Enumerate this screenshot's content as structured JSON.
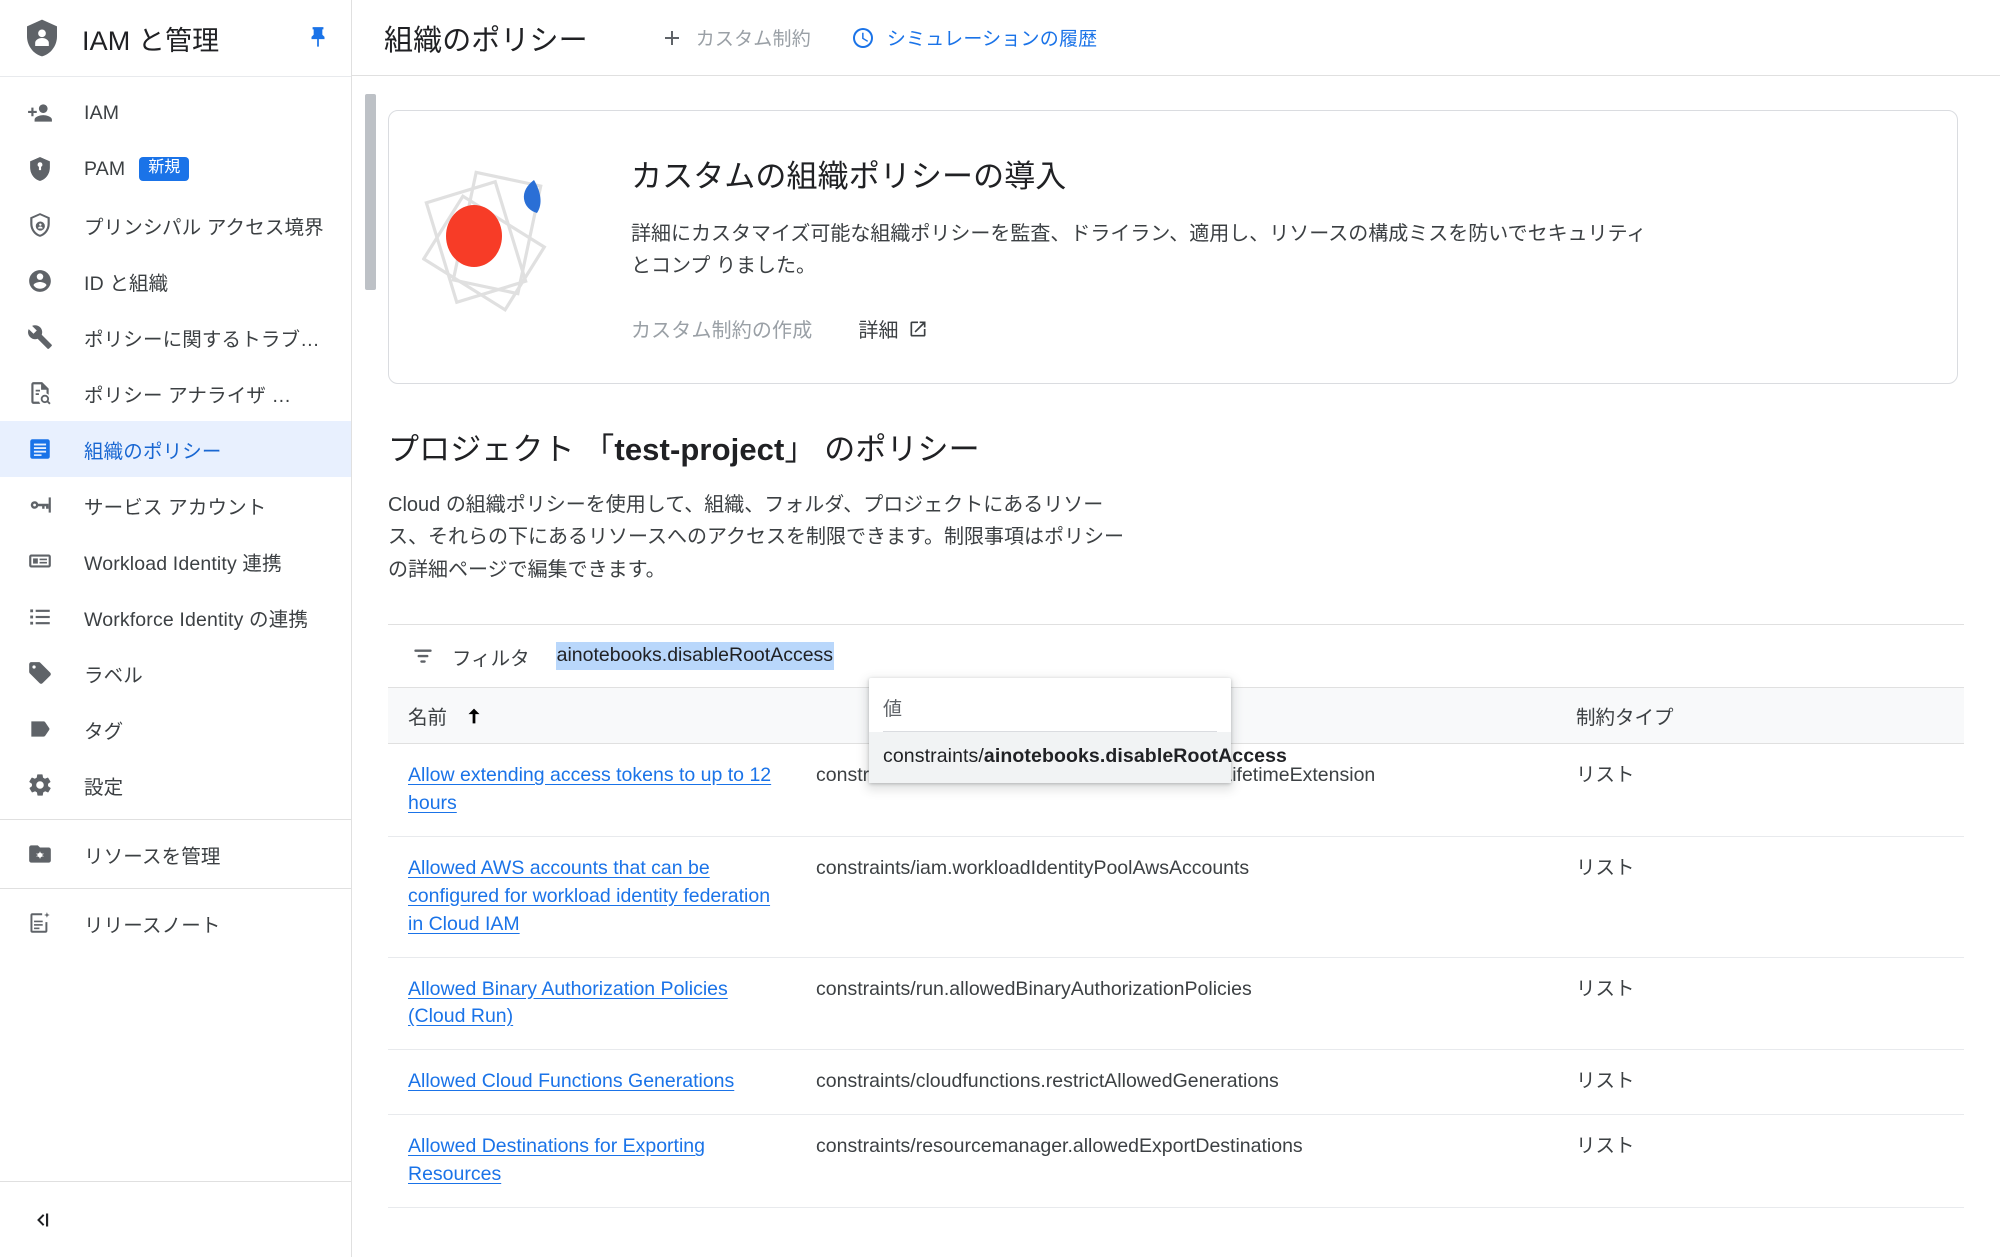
{
  "sidebar": {
    "header": {
      "title": "IAM と管理",
      "icon": "shield-person-icon",
      "pin_icon": "pin-icon"
    },
    "items": [
      {
        "label": "IAM",
        "icon": "person-add-icon",
        "active": false,
        "badge": ""
      },
      {
        "label": "PAM",
        "icon": "shield-key-icon",
        "active": false,
        "badge": "新規"
      },
      {
        "label": "プリンシパル アクセス境界",
        "icon": "shield-user-icon",
        "active": false,
        "badge": ""
      },
      {
        "label": "ID と組織",
        "icon": "account-circle-icon",
        "active": false,
        "badge": ""
      },
      {
        "label": "ポリシーに関するトラブ…",
        "icon": "wrench-icon",
        "active": false,
        "badge": ""
      },
      {
        "label": "ポリシー アナライザ …",
        "icon": "document-search-icon",
        "active": false,
        "badge": ""
      },
      {
        "label": "組織のポリシー",
        "icon": "policy-document-icon",
        "active": true,
        "badge": ""
      },
      {
        "label": "サービス アカウント",
        "icon": "key-card-icon",
        "active": false,
        "badge": ""
      },
      {
        "label": "Workload Identity 連携",
        "icon": "id-card-icon",
        "active": false,
        "badge": ""
      },
      {
        "label": "Workforce Identity の連携",
        "icon": "list-icon",
        "active": false,
        "badge": ""
      },
      {
        "label": "ラベル",
        "icon": "label-icon",
        "active": false,
        "badge": ""
      },
      {
        "label": "タグ",
        "icon": "tag-icon",
        "active": false,
        "badge": ""
      },
      {
        "label": "設定",
        "icon": "gear-icon",
        "active": false,
        "badge": ""
      }
    ],
    "footer_items": [
      {
        "label": "リソースを管理",
        "icon": "folder-gear-icon"
      },
      {
        "label": "リリースノート",
        "icon": "release-notes-icon"
      }
    ],
    "collapse_icon": "collapse-panel-icon"
  },
  "topbar": {
    "page_title": "組織のポリシー",
    "custom_constraint_label": "カスタム制約",
    "custom_constraint_icon": "plus-icon",
    "simulation_history_label": "シミュレーションの履歴",
    "simulation_history_icon": "clock-history-icon"
  },
  "promo": {
    "title": "カスタムの組織ポリシーの導入",
    "description": "詳細にカスタマイズ可能な組織ポリシーを監査、ドライラン、適用し、リソースの構成ミスを防いでセキュリティとコンプ\nりました。",
    "create_label": "カスタム制約の作成",
    "detail_label": "詳細",
    "detail_icon": "external-link-icon",
    "art_icon": "policy-illustration"
  },
  "section": {
    "title_prefix": "プロジェクト 「",
    "title_project": "test-project",
    "title_suffix": "」 のポリシー",
    "description": "Cloud の組織ポリシーを使用して、組織、フォルダ、プロジェクトにあるリソース、それらの下にあるリソースへのアクセスを制限できます。制限事項はポリシーの詳細ページで編集できます。"
  },
  "filter": {
    "icon": "filter-list-icon",
    "label": "フィルタ",
    "value": "ainotebooks.disableRootAccess",
    "selected": true
  },
  "autocomplete": {
    "field_label": "値",
    "option_prefix": "constraints/",
    "option_bold": "ainotebooks.disableRootAccess"
  },
  "table": {
    "columns": [
      {
        "key": "name",
        "label": "名前",
        "sort_icon": "arrow-up-icon"
      },
      {
        "key": "id",
        "label": "",
        "sort_icon": ""
      },
      {
        "key": "type",
        "label": "制約タイプ",
        "sort_icon": ""
      }
    ],
    "rows": [
      {
        "name": "Allow extending access tokens to up to 12 hours",
        "id": "constraints/iam.allowServiceAccountCredentialLifetimeExtension",
        "type": "リスト"
      },
      {
        "name": "Allowed AWS accounts that can be configured for workload identity federation in Cloud IAM",
        "id": "constraints/iam.workloadIdentityPoolAwsAccounts",
        "type": "リスト"
      },
      {
        "name": "Allowed Binary Authorization Policies (Cloud Run)",
        "id": "constraints/run.allowedBinaryAuthorizationPolicies",
        "type": "リスト"
      },
      {
        "name": "Allowed Cloud Functions Generations",
        "id": "constraints/cloudfunctions.restrictAllowedGenerations",
        "type": "リスト"
      },
      {
        "name": "Allowed Destinations for Exporting Resources",
        "id": "constraints/resourcemanager.allowedExportDestinations",
        "type": "リスト"
      }
    ]
  },
  "colors": {
    "accent": "#1a73e8",
    "active_bg": "#e8f0fe",
    "active_text": "#1967d2",
    "selection": "#b9d7fb",
    "badge": "#1a73e8",
    "art_red": "#ea4335",
    "art_blue": "#1a73e8"
  }
}
